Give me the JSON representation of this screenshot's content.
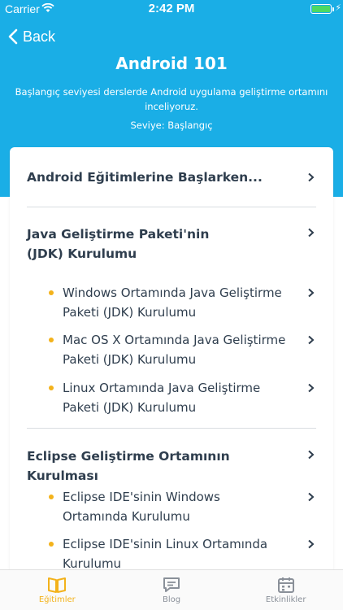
{
  "status_bar": {
    "carrier": "Carrier",
    "time": "2:42 PM"
  },
  "nav": {
    "back_label": "Back"
  },
  "course": {
    "title": "Android 101",
    "description": "Başlangıç seviyesi derslerde Android uygulama geliştirme ortamını inceliyoruz.",
    "level": "Seviye: Başlangıç"
  },
  "lessons": {
    "section1": {
      "title": "Android Eğitimlerine Başlarken..."
    },
    "section2": {
      "title": "Java Geliştirme Paketi'nin (JDK) Kurulumu",
      "items": [
        {
          "label": " Windows Ortamında Java Geliştirme Paketi (JDK) Kurulumu"
        },
        {
          "label": "Mac OS X Ortamında Java Geliştirme Paketi (JDK) Kurulumu"
        },
        {
          "label": "Linux Ortamında Java Geliştirme Paketi (JDK) Kurulumu"
        }
      ]
    },
    "section3": {
      "title": "Eclipse Geliştirme Ortamının Kurulması",
      "items": [
        {
          "label": "Eclipse IDE'sinin Windows Ortamında Kurulumu"
        },
        {
          "label": "Eclipse IDE'sinin Linux Ortamında Kurulumu"
        }
      ]
    }
  },
  "tabs": [
    {
      "label": "Eğitimler",
      "icon": "book-icon",
      "active": true
    },
    {
      "label": "Blog",
      "icon": "chat-icon",
      "active": false
    },
    {
      "label": "Etkinlikler",
      "icon": "calendar-icon",
      "active": false
    }
  ],
  "colors": {
    "header": "#1aaee6",
    "accent": "#f3b21b",
    "text": "#2f3e4e",
    "battery": "#4cd964"
  }
}
